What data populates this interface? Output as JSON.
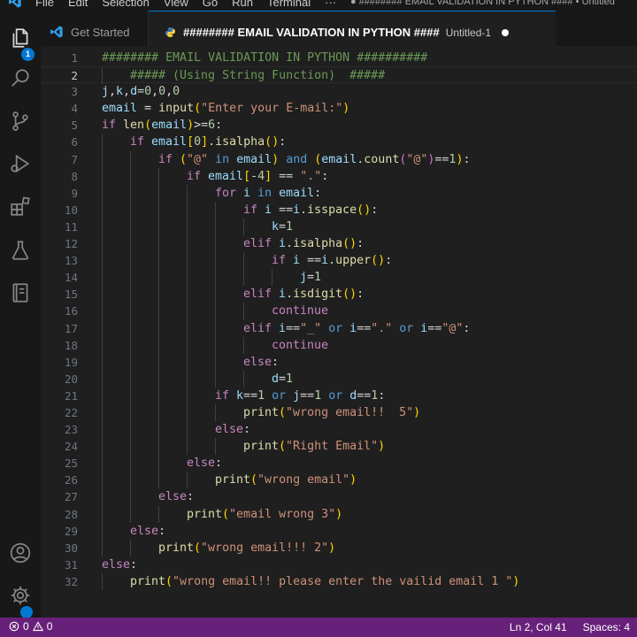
{
  "titlebar": {
    "menu": [
      "File",
      "Edit",
      "Selection",
      "View",
      "Go",
      "Run",
      "Terminal",
      "···"
    ],
    "window_title": "● ######## EMAIL VALIDATION IN PYTHON #### • Untitled"
  },
  "activitybar": {
    "explorer_badge": "1",
    "items": [
      "explorer",
      "search",
      "source-control",
      "run-debug",
      "extensions",
      "testing",
      "notebook",
      "accounts",
      "manage"
    ]
  },
  "tabs": [
    {
      "label": "Get Started",
      "active": false
    },
    {
      "label": "######## EMAIL VALIDATION IN PYTHON ####",
      "description": "Untitled-1",
      "dirty": true,
      "active": true
    }
  ],
  "editor": {
    "cursor_line": 2,
    "lines": [
      {
        "n": "1",
        "indent": 0,
        "code": "######## EMAIL VALIDATION IN PYTHON ##########"
      },
      {
        "n": "2",
        "indent": 1,
        "code": "##### (Using String Function)  #####"
      },
      {
        "n": "3",
        "indent": 0,
        "code": "j,k,d=0,0,0"
      },
      {
        "n": "4",
        "indent": 0,
        "code": "email = input(\"Enter your E-mail:\")"
      },
      {
        "n": "5",
        "indent": 0,
        "code": "if len(email)>=6:"
      },
      {
        "n": "6",
        "indent": 1,
        "code": "if email[0].isalpha():"
      },
      {
        "n": "7",
        "indent": 2,
        "code": "if (\"@\" in email) and (email.count(\"@\")==1):"
      },
      {
        "n": "8",
        "indent": 3,
        "code": "if email[-4] == \".\":"
      },
      {
        "n": "9",
        "indent": 4,
        "code": "for i in email:"
      },
      {
        "n": "10",
        "indent": 5,
        "code": "if i ==i.isspace():"
      },
      {
        "n": "11",
        "indent": 6,
        "code": "k=1"
      },
      {
        "n": "12",
        "indent": 5,
        "code": "elif i.isalpha():"
      },
      {
        "n": "13",
        "indent": 6,
        "code": "if i ==i.upper():"
      },
      {
        "n": "14",
        "indent": 7,
        "code": "j=1"
      },
      {
        "n": "15",
        "indent": 5,
        "code": "elif i.isdigit():"
      },
      {
        "n": "16",
        "indent": 6,
        "code": "continue"
      },
      {
        "n": "17",
        "indent": 5,
        "code": "elif i==\"_\" or i==\".\" or i==\"@\":"
      },
      {
        "n": "18",
        "indent": 6,
        "code": "continue"
      },
      {
        "n": "19",
        "indent": 5,
        "code": "else:"
      },
      {
        "n": "20",
        "indent": 6,
        "code": "d=1"
      },
      {
        "n": "21",
        "indent": 4,
        "code": "if k==1 or j==1 or d==1:"
      },
      {
        "n": "22",
        "indent": 5,
        "code": "print(\"wrong email!!  5\")"
      },
      {
        "n": "23",
        "indent": 4,
        "code": "else:"
      },
      {
        "n": "24",
        "indent": 5,
        "code": "print(\"Right Email\")"
      },
      {
        "n": "25",
        "indent": 3,
        "code": "else:"
      },
      {
        "n": "26",
        "indent": 4,
        "code": "print(\"wrong email\")"
      },
      {
        "n": "27",
        "indent": 2,
        "code": "else:"
      },
      {
        "n": "28",
        "indent": 3,
        "code": "print(\"email wrong 3\")"
      },
      {
        "n": "29",
        "indent": 1,
        "code": "else:"
      },
      {
        "n": "30",
        "indent": 2,
        "code": "print(\"wrong email!!! 2\")"
      },
      {
        "n": "31",
        "indent": 0,
        "code": "else:"
      },
      {
        "n": "32",
        "indent": 1,
        "code": "print(\"wrong email!! please enter the vailid email 1 \")"
      }
    ]
  },
  "statusbar": {
    "errors": "0",
    "warnings": "0",
    "position": "Ln 2, Col 41",
    "spaces": "Spaces: 4"
  },
  "colors": {
    "statusbar": "#68217a",
    "accent": "#0078d4",
    "editor_bg": "#1f1f1f"
  }
}
